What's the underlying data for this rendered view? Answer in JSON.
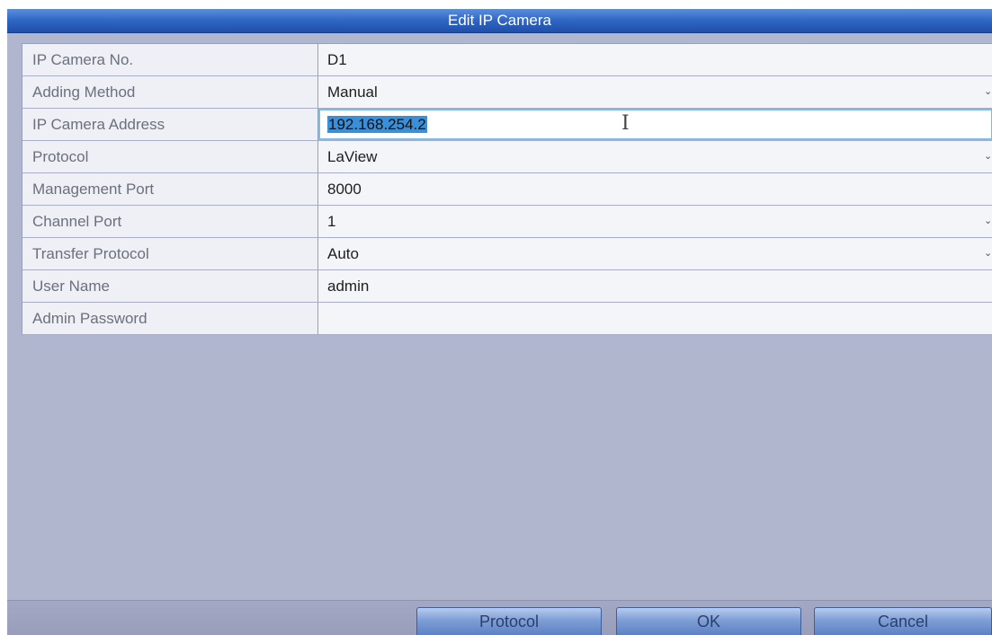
{
  "dialog": {
    "title": "Edit IP Camera"
  },
  "fields": [
    {
      "label": "IP Camera No.",
      "value": "D1",
      "has_dropdown": false,
      "active": false
    },
    {
      "label": "Adding Method",
      "value": "Manual",
      "has_dropdown": true,
      "active": false
    },
    {
      "label": "IP Camera Address",
      "value": "192.168.254.2",
      "has_dropdown": false,
      "active": true,
      "selected": true
    },
    {
      "label": "Protocol",
      "value": "LaView",
      "has_dropdown": true,
      "active": false
    },
    {
      "label": "Management Port",
      "value": "8000",
      "has_dropdown": false,
      "active": false
    },
    {
      "label": "Channel Port",
      "value": "1",
      "has_dropdown": true,
      "active": false
    },
    {
      "label": "Transfer Protocol",
      "value": "Auto",
      "has_dropdown": true,
      "active": false
    },
    {
      "label": "User Name",
      "value": "admin",
      "has_dropdown": false,
      "active": false
    },
    {
      "label": "Admin Password",
      "value": "",
      "has_dropdown": false,
      "active": false
    }
  ],
  "buttons": {
    "protocol_label": "Protocol",
    "ok_label": "OK",
    "cancel_label": "Cancel"
  },
  "icons": {
    "dropdown": "chevron-down-icon",
    "cursor": "text-cursor-icon"
  },
  "colors": {
    "titlebar": "#2f65c4",
    "dialog_background": "#b1b6cf",
    "selection": "#3b8fd6",
    "active_field_border": "#7bbce8",
    "button": "#7e9ed6"
  }
}
